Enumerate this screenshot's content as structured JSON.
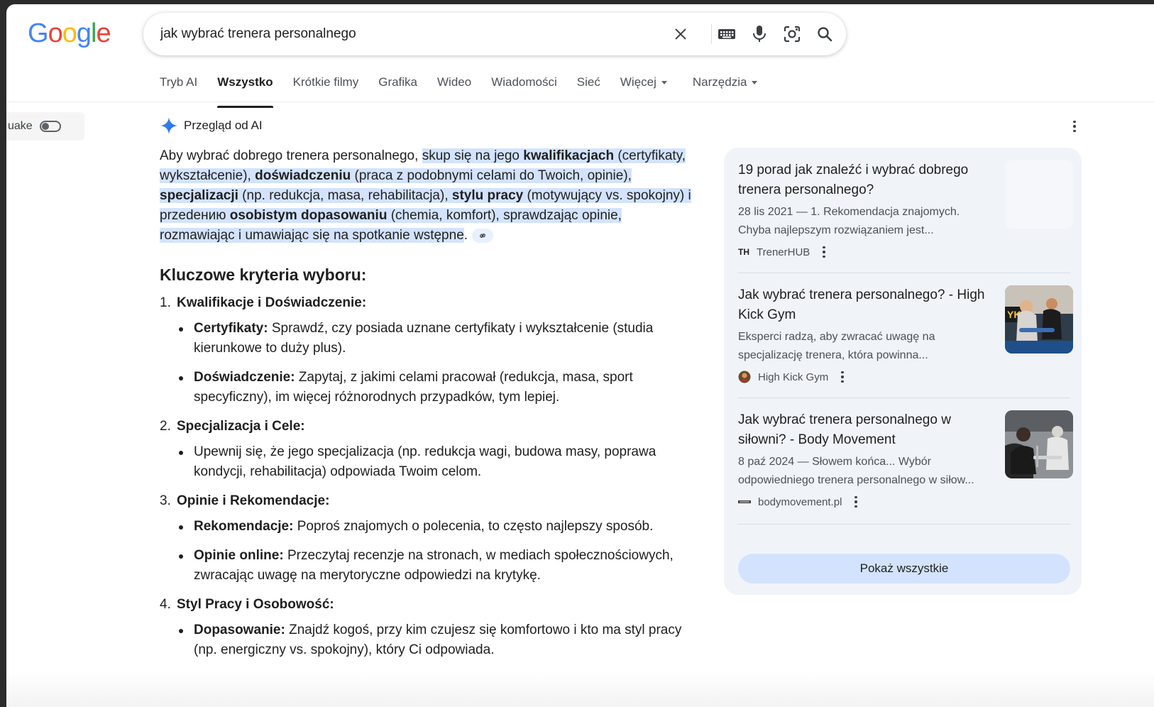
{
  "search": {
    "query": "jak wybrać trenera personalnego"
  },
  "tabs": [
    {
      "label": "Tryb AI"
    },
    {
      "label": "Wszystko"
    },
    {
      "label": "Krótkie filmy"
    },
    {
      "label": "Grafika"
    },
    {
      "label": "Wideo"
    },
    {
      "label": "Wiadomości"
    },
    {
      "label": "Sieć"
    },
    {
      "label": "Więcej"
    },
    {
      "label": "Narzędzia"
    }
  ],
  "side_toggle": {
    "label": "uake"
  },
  "ai_overview": {
    "title": "Przegląd od AI",
    "intro_plain": "Aby wybrać dobrego trenera personalnego, ",
    "intro_hl_1": "skup się na jego ",
    "intro_b1": "kwalifikacjach",
    "intro_t2": " (certyfikaty, wykształcenie), ",
    "intro_b2": "doświadczeniu",
    "intro_t3": " (praca z podobnymi celami do Twoich, opinie), ",
    "intro_b3": "specjalizacji",
    "intro_t4": " (np. redukcja, masa, rehabilitacja), ",
    "intro_b4": "stylu pracy",
    "intro_t5": " (motywujący vs. spokojny) i przedeнию ",
    "intro_b5": "osobistym dopasowaniu",
    "intro_t6": " (chemia, komfort), sprawdzając opinie, rozmawiając i umawiając się na spotkanie wstępne",
    "intro_end": ".",
    "heading": "Kluczowe kryteria wyboru:",
    "sections": [
      {
        "num": "1.",
        "title": "Kwalifikacje i Doświadczenie:",
        "bullets": [
          {
            "bold": "Certyfikaty:",
            "text": " Sprawdź, czy posiada uznane certyfikaty i wykształcenie (studia kierunkowe to duży plus)."
          },
          {
            "bold": "Doświadczenie:",
            "text": " Zapytaj, z jakimi celami pracował (redukcja, masa, sport specyficzny), im więcej różnorodnych przypadków, tym lepiej."
          }
        ]
      },
      {
        "num": "2.",
        "title": "Specjalizacja i Cele:",
        "bullets": [
          {
            "bold": "",
            "text": "Upewnij się, że jego specjalizacja (np. redukcja wagi, budowa masy, poprawa kondycji, rehabilitacja) odpowiada Twoim celom."
          }
        ]
      },
      {
        "num": "3.",
        "title": "Opinie i Rekomendacje:",
        "bullets": [
          {
            "bold": "Rekomendacje:",
            "text": " Poproś znajomych o polecenia, to często najlepszy sposób."
          },
          {
            "bold": "Opinie online:",
            "text": " Przeczytaj recenzje na stronach, w mediach społecznościowych, zwracając uwagę na merytoryczne odpowiedzi na krytykę."
          }
        ]
      },
      {
        "num": "4.",
        "title": "Styl Pracy i Osobowość:",
        "bullets": [
          {
            "bold": "Dopasowanie:",
            "text": " Znajdź kogoś, przy kim czujesz się komfortowo i kto ma styl pracy (np. energiczny vs. spokojny), który Ci odpowiada."
          }
        ]
      }
    ]
  },
  "sources": [
    {
      "title": "19 porad jak znaleźć i wybrać dobrego trenera personalnego?",
      "snippet": "28 lis 2021 — 1. Rekomendacja znajomych. Chyba najlepszym rozwiązaniem jest...",
      "site": "TrenerHUB",
      "fav_text": "TH"
    },
    {
      "title": "Jak wybrać trenera personalnego? - High Kick Gym",
      "snippet": "Eksperci radzą, aby zwracać uwagę na specjalizację trenera, która powinna...",
      "site": "High Kick Gym"
    },
    {
      "title": "Jak wybrać trenera personalnego w siłowni? - Body Movement",
      "snippet": "8 paź 2024 — Słowem końca... Wybór odpowiedniego trenera personalnego w siłow...",
      "site": "bodymovement.pl"
    }
  ],
  "show_all_label": "Pokaż wszystkie"
}
